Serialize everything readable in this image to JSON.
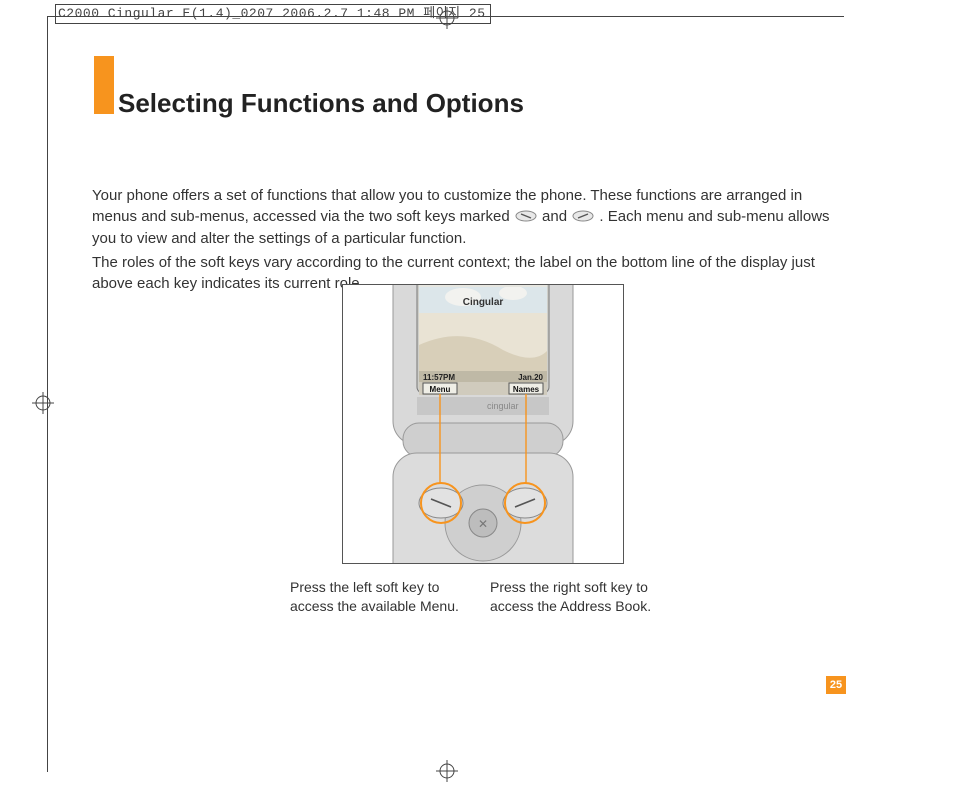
{
  "print_header": "C2000 Cingular E(1.4)_0207  2006.2.7 1:48 PM  페이지 25",
  "title": "Selecting Functions and Options",
  "paragraphs": {
    "p1a": "Your phone offers a set of functions that allow you to customize the phone. These functions are arranged in menus and sub-menus, accessed via the two soft keys marked ",
    "p1b": " and ",
    "p1c": ". Each menu and sub-menu allows you to view and alter the settings of a particular function.",
    "p2": "The roles of the soft keys vary according to the current context; the label on the bottom line of the display just above each key indicates its current role."
  },
  "figure": {
    "carrier": "Cingular",
    "brand": "cingular",
    "time": "11:57PM",
    "date": "Jan.20",
    "left_soft_label": "Menu",
    "right_soft_label": "Names"
  },
  "captions": {
    "left": "Press the left soft key to access the available Menu.",
    "right": "Press the right soft key to access the Address Book."
  },
  "page_number": "25",
  "colors": {
    "accent": "#f7941e"
  }
}
